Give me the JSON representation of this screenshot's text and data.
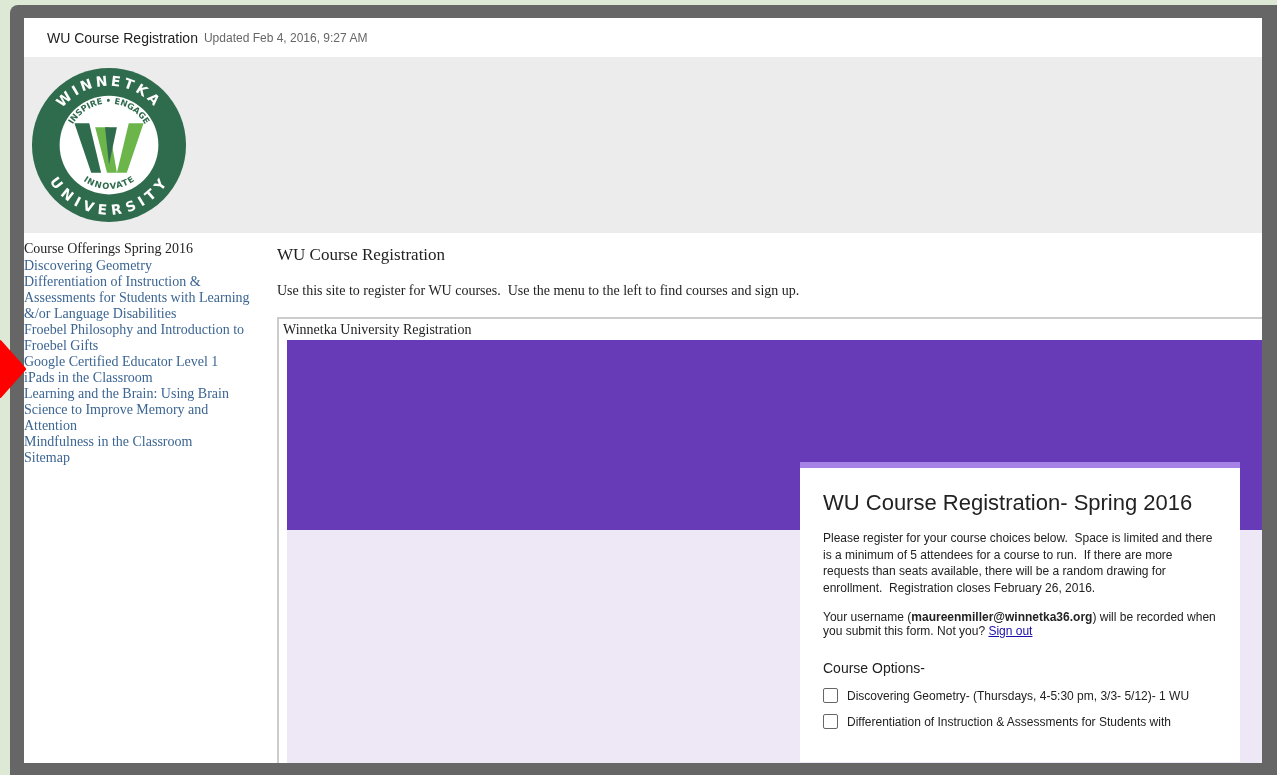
{
  "site_header": {
    "title": "WU Course Registration",
    "updated": "Updated Feb 4, 2016, 9:27 AM"
  },
  "logo": {
    "top_text": "WINNETKA",
    "bottom_text": "UNIVERSITY",
    "inner_top": "INSPIRE • ENGAGE",
    "inner_bottom": "INNOVATE"
  },
  "sidebar": {
    "heading": "Course Offerings Spring 2016",
    "items": [
      {
        "label": "Discovering Geometry"
      },
      {
        "label": "Differentiation of Instruction & Assessments for Students with Learning &/or Language Disabilities"
      },
      {
        "label": "Froebel Philosophy and Introduction to Froebel Gifts"
      },
      {
        "label": "Google Certified Educator Level 1"
      },
      {
        "label": "iPads in the Classroom"
      },
      {
        "label": "Learning and the Brain: Using Brain Science to Improve Memory and Attention"
      },
      {
        "label": "Mindfulness in the Classroom"
      },
      {
        "label": "Sitemap"
      }
    ]
  },
  "main": {
    "title": "WU Course Registration",
    "intro": "Use this site to register for WU courses.  Use the menu to the left to find courses and sign up."
  },
  "embed": {
    "title": "Winnetka University Registration",
    "form": {
      "title": "WU Course Registration- Spring 2016",
      "description": "Please register for your course choices below.  Space is limited and there is a minimum of 5 attendees for a course to run.  If there are more requests than seats available, there will be a random drawing for enrollment.  Registration closes February 26, 2016.",
      "username_note": "Your username (**maureenmiller@winnetka36.org**) will be recorded when you submit this form. Not you?",
      "sign_out": "Sign out",
      "section": "Course Options-",
      "options": [
        {
          "label": "Discovering Geometry- (Thursdays, 4-5:30 pm, 3/3- 5/12)- 1 WU",
          "checked": false
        },
        {
          "label": "Differentiation of Instruction & Assessments for Students with",
          "checked": false
        }
      ]
    }
  }
}
